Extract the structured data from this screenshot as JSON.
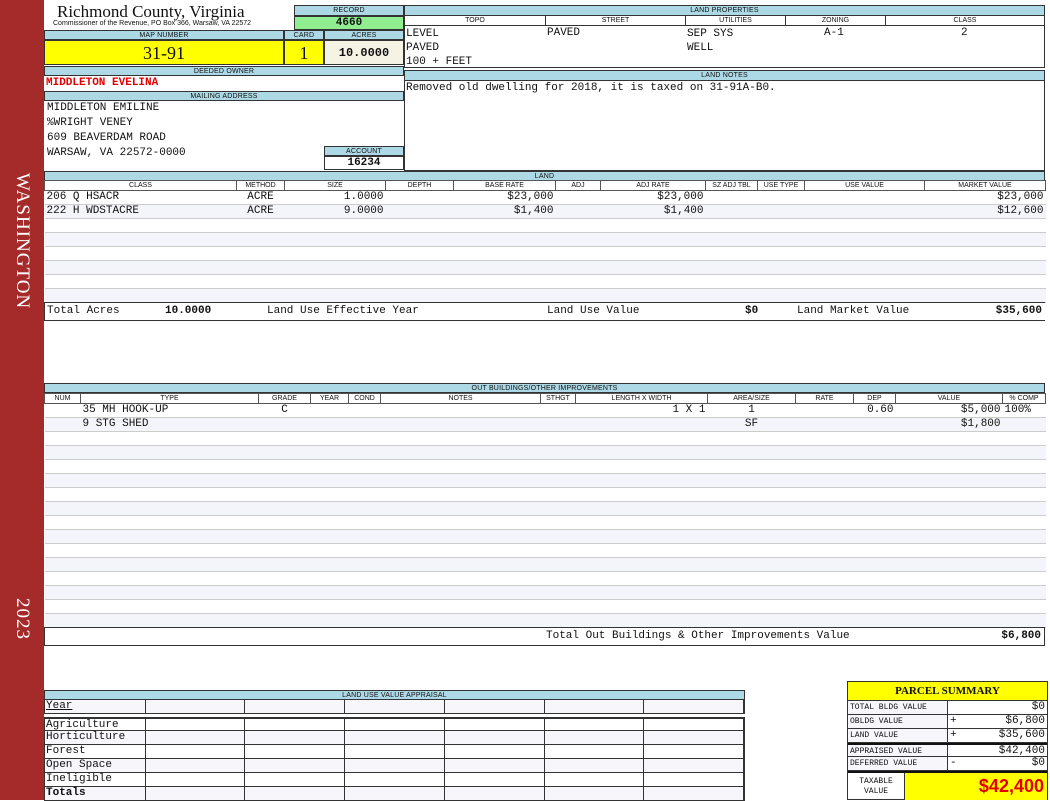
{
  "sidebar": {
    "locality": "WASHINGTON",
    "year": "2023"
  },
  "header": {
    "title": "Richmond County, Virginia",
    "subtitle": "Commissioner of the Revenue, PO Box 366, Warsaw, VA 22572"
  },
  "record": {
    "label": "RECORD",
    "value": "4660"
  },
  "map": {
    "map_label": "MAP NUMBER",
    "map_value": "31-91",
    "card_label": "CARD",
    "card_value": "1",
    "acres_label": "ACRES",
    "acres_value": "10.0000"
  },
  "owner": {
    "label": "DEEDED OWNER",
    "name": "MIDDLETON EVELINA"
  },
  "mailing": {
    "label": "MAILING ADDRESS",
    "lines": [
      "MIDDLETON EMILINE",
      "%WRIGHT VENEY",
      "609 BEAVERDAM ROAD",
      "WARSAW, VA 22572-0000"
    ]
  },
  "account": {
    "label": "ACCOUNT",
    "value": "16234"
  },
  "land_properties": {
    "label": "LAND PROPERTIES",
    "headers": [
      "TOPO",
      "STREET",
      "UTILITIES",
      "ZONING",
      "CLASS"
    ],
    "topo": [
      "LEVEL",
      "PAVED",
      "100 + FEET"
    ],
    "street": "PAVED",
    "utilities": [
      "SEP SYS",
      "WELL"
    ],
    "zoning": "A-1",
    "class": "2"
  },
  "land_notes": {
    "label": "LAND NOTES",
    "text": "Removed old dwelling for 2018, it is taxed on 31-91A-B0."
  },
  "land": {
    "label": "LAND",
    "headers": [
      "CLASS",
      "METHOD",
      "SIZE",
      "DEPTH",
      "BASE RATE",
      "ADJ",
      "ADJ RATE",
      "SZ ADJ TBL",
      "USE TYPE",
      "USE VALUE",
      "MARKET VALUE"
    ],
    "rows": [
      [
        "206 Q HSACR",
        "ACRE",
        "1.0000",
        "",
        "$23,000",
        "",
        "$23,000",
        "",
        "",
        "",
        "$23,000"
      ],
      [
        "222 H WDSTACRE",
        "ACRE",
        "9.0000",
        "",
        "$1,400",
        "",
        "$1,400",
        "",
        "",
        "",
        "$12,600"
      ]
    ],
    "totals": {
      "acres_label": "Total Acres",
      "acres": "10.0000",
      "eff_year_label": "Land Use Effective Year",
      "eff_year": "",
      "use_value_label": "Land Use Value",
      "use_value": "$0",
      "market_label": "Land Market Value",
      "market_value": "$35,600"
    }
  },
  "outbuildings": {
    "label": "OUT BUILDINGS/OTHER IMPROVEMENTS",
    "headers": [
      "NUM",
      "TYPE",
      "GRADE",
      "YEAR",
      "COND",
      "NOTES",
      "STHGT",
      "LENGTH X WIDTH",
      "AREA/SIZE",
      "RATE",
      "DEP",
      "VALUE",
      "% COMP"
    ],
    "rows": [
      [
        "",
        "35  MH HOOK-UP",
        "C",
        "",
        "",
        "",
        "",
        "1 X 1",
        "1",
        "",
        "0.60",
        "$5,000",
        "100%"
      ],
      [
        "",
        "9  STG SHED",
        "",
        "",
        "",
        "",
        "",
        "",
        "SF",
        "",
        "",
        "$1,800",
        ""
      ]
    ],
    "total_label": "Total Out Buildings & Other Improvements Value",
    "total_value": "$6,800"
  },
  "land_use": {
    "label": "LAND USE VALUE APPRAISAL",
    "year_label": "Year",
    "rows": [
      "Agriculture",
      "Horticulture",
      "Forest",
      "Open Space",
      "Ineligible"
    ],
    "totals_label": "Totals"
  },
  "summary": {
    "title": "PARCEL SUMMARY",
    "items": [
      {
        "label": "TOTAL BLDG VALUE",
        "sign": "",
        "value": "$0"
      },
      {
        "label": "OBLDG VALUE",
        "sign": "+",
        "value": "$6,800"
      },
      {
        "label": "LAND VALUE",
        "sign": "+",
        "value": "$35,600"
      },
      {
        "label": "APPRAISED VALUE",
        "sign": "",
        "value": "$42,400"
      },
      {
        "label": "DEFERRED VALUE",
        "sign": "-",
        "value": "$0"
      }
    ],
    "taxable_label": "TAXABLE VALUE",
    "taxable_value": "$42,400"
  },
  "colors": {
    "sidebar": "#a52a2a",
    "header_band": "#add8e6",
    "highlight": "#ffff00",
    "record": "#90ee90",
    "owner": "#e00000"
  }
}
